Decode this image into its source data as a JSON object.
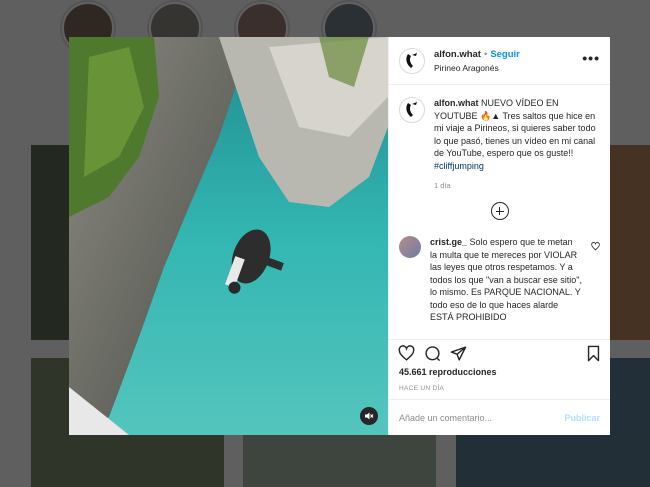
{
  "post": {
    "username": "alfon.what",
    "separator": "•",
    "follow_label": "Seguir",
    "location": "Pirineo Aragonés",
    "more_label": "•••",
    "caption_user": "alfon.what",
    "caption_text": " NUEVO VÍDEO EN YOUTUBE 🔥▲ Tres saltos que hice en mi viaje a Pirineos, si quieres saber todo lo que pasó, tienes un vídeo en mi canal de YouTube, espero que os guste!! ",
    "caption_tag": "#cliffjumping",
    "caption_time": "1 día",
    "comment": {
      "user": "crist.ge_",
      "text": " Solo espero que te metan la multa que te mereces por VIOLAR las leyes que otros respetamos. Y a todos los que \"van a buscar ese sitio\", lo mismo. Es PARQUE NACIONAL. Y todo eso de lo que haces alarde ESTÁ PROHIBIDO"
    },
    "views": "45.661 reproducciones",
    "posted_ago": "HACE UN DÍA",
    "add_comment_placeholder": "Añade un comentario...",
    "publish_label": "Publicar"
  },
  "icons": [
    "load-more-icon",
    "heart-icon",
    "comment-icon",
    "share-icon",
    "save-icon",
    "mute-icon"
  ],
  "colors": {
    "accent": "#0095f6",
    "publish_disabled": "#b2dffc",
    "water": "#2aa7a5"
  }
}
